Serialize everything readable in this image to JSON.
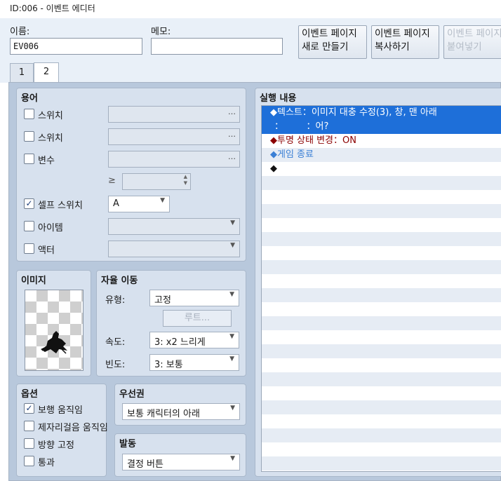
{
  "window": {
    "title": "ID:006 - 이벤트 에디터"
  },
  "header": {
    "name_label": "이름:",
    "name_value": "EV006",
    "memo_label": "메모:",
    "memo_value": "",
    "btn_new_page": [
      "이벤트 페이지",
      "새로 만들기"
    ],
    "btn_copy_page": [
      "이벤트 페이지",
      "복사하기"
    ],
    "btn_paste_page": [
      "이벤트 페이지",
      "붙여넣기"
    ]
  },
  "tabs": [
    {
      "label": "1"
    },
    {
      "label": "2"
    }
  ],
  "conditions": {
    "title": "용어",
    "rows": [
      {
        "label": "스위치",
        "checked": false
      },
      {
        "label": "스위치",
        "checked": false
      },
      {
        "label": "변수",
        "checked": false
      },
      {
        "label": "셀프 스위치",
        "checked": true,
        "value": "A"
      },
      {
        "label": "아이템",
        "checked": false
      },
      {
        "label": "액터",
        "checked": false
      }
    ],
    "ge_symbol": "≥",
    "dots": "…"
  },
  "image": {
    "title": "이미지"
  },
  "autonomous": {
    "title": "자율 이동",
    "type_label": "유형:",
    "type_value": "고정",
    "route_label": "루트...",
    "speed_label": "속도:",
    "speed_value": "3: x2 느리게",
    "freq_label": "빈도:",
    "freq_value": "3: 보통"
  },
  "options": {
    "title": "옵션",
    "items": [
      {
        "label": "보행 움직임",
        "checked": true
      },
      {
        "label": "제자리걸음 움직임",
        "checked": false
      },
      {
        "label": "방향 고정",
        "checked": false
      },
      {
        "label": "통과",
        "checked": false
      }
    ]
  },
  "priority": {
    "title": "우선권",
    "value": "보통 캐릭터의 아래"
  },
  "trigger": {
    "title": "발동",
    "value": "결정 버튼"
  },
  "contents": {
    "title": "실행 내용",
    "lines": [
      {
        "text": "◆텍스트：이미지 대충 수정(3), 창, 맨 아래",
        "selected": true,
        "color": "#ffffff"
      },
      {
        "text": "：　　　：어?",
        "selected": true,
        "color": "#ffffff"
      },
      {
        "text": "◆투명 상태 변경：ON",
        "selected": false,
        "color": "#8b0000"
      },
      {
        "text": "◆게임 종료",
        "selected": false,
        "color": "#3a7fd5"
      },
      {
        "text": "◆",
        "selected": false,
        "color": "#111111"
      }
    ]
  },
  "colors": {
    "selection": "#1e6fd9",
    "accent": "#1d3e7a"
  }
}
